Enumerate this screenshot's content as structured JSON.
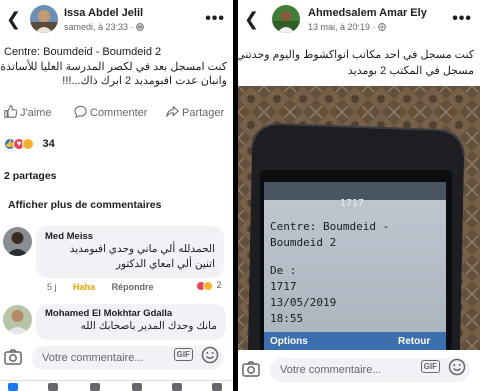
{
  "left_post": {
    "author": "Issa Abdel Jelil",
    "timestamp": "samedi, à 23:33 ·",
    "text_line1": "Centre: Boumdeid - Boumdeid 2",
    "text_line2": "كنت امسجل بعد في لكصر المدرسة العليا للأساتذة",
    "text_line3": "وانبان عدت افبومديد 2 ابرك ذاك...!!!",
    "like_label": "J'aime",
    "comment_label": "Commenter",
    "share_label": "Partager",
    "reaction_count": "34",
    "shares_text": "2 partages",
    "more_comments": "Afficher plus de commentaires",
    "comments": [
      {
        "author": "Med Meiss",
        "text_line1": "الحمدلله ألي ماني وحدي افبومديد",
        "text_line2": "اتنين ألي امعاي الدكتور",
        "time": "5 j",
        "reaction": "Haha",
        "reply": "Répondre",
        "reaction_count": "2"
      },
      {
        "author": "Mohamed El Mokhtar Gdalla",
        "text_line1": "مانك وحدك المدير باصحابك الله"
      }
    ],
    "comment_placeholder": "Votre commentaire...",
    "gif_label": "GIF"
  },
  "right_post": {
    "author": "Ahmedsalem Amar Ely",
    "timestamp": "13 mai, à 20:19 ·",
    "text_line1": "كنت مسجل في احد مكاتب انواكشوط واليوم وجدتني",
    "text_line2": "مسجل في المكتب 2 بومديد",
    "phone_screen": {
      "number": "1717",
      "line1": "Centre: Boumdeid -",
      "line2": "Boumdeid 2",
      "line3": "De :",
      "line4": "1717",
      "line5": "13/05/2019",
      "line6": "18:55",
      "softkey_left": "Options",
      "softkey_right": "Retour"
    },
    "comment_placeholder": "Votre commentaire...",
    "gif_label": "GIF"
  },
  "colors": {
    "facebook_blue": "#1877f2",
    "text_primary": "#1c1e21",
    "text_secondary": "#65676b",
    "bubble_bg": "#f0f2f5",
    "like_blue": "#1877f2",
    "love_red": "#f33e58",
    "haha_yellow": "#f7b125"
  }
}
